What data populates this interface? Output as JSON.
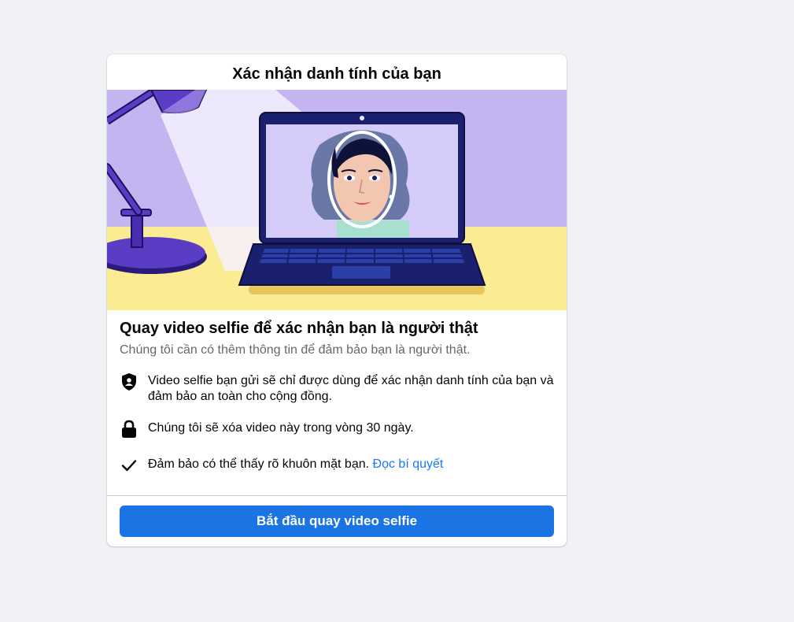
{
  "dialog": {
    "title": "Xác nhận danh tính của bạn"
  },
  "illustration": {
    "subject": "woman-on-laptop-screen-with-desk-lamp",
    "colors": {
      "wall": "#c4b5f0",
      "desk": "#fbeb92",
      "laptop": "#1a1f6e",
      "lamp": "#5b3cc4"
    }
  },
  "content": {
    "headline": "Quay video selfie để xác nhận bạn là người thật",
    "subtext": "Chúng tôi cần có thêm thông tin để đảm bảo bạn là người thật.",
    "items": [
      {
        "icon": "shield-person-icon",
        "text": "Video selfie bạn gửi sẽ chỉ được dùng để xác nhận danh tính của bạn và đảm bảo an toàn cho cộng đồng."
      },
      {
        "icon": "lock-icon",
        "text": "Chúng tôi sẽ xóa video này trong vòng 30 ngày."
      },
      {
        "icon": "checkmark-icon",
        "text": "Đảm bảo có thể thấy rõ khuôn mặt bạn.",
        "link": "Đọc bí quyết"
      }
    ]
  },
  "footer": {
    "button_label": "Bắt đầu quay video selfie",
    "button_color": "#1b74e4"
  },
  "colors": {
    "background": "#f0f2f5",
    "link": "#1877f2",
    "secondary_text": "#65676b"
  }
}
